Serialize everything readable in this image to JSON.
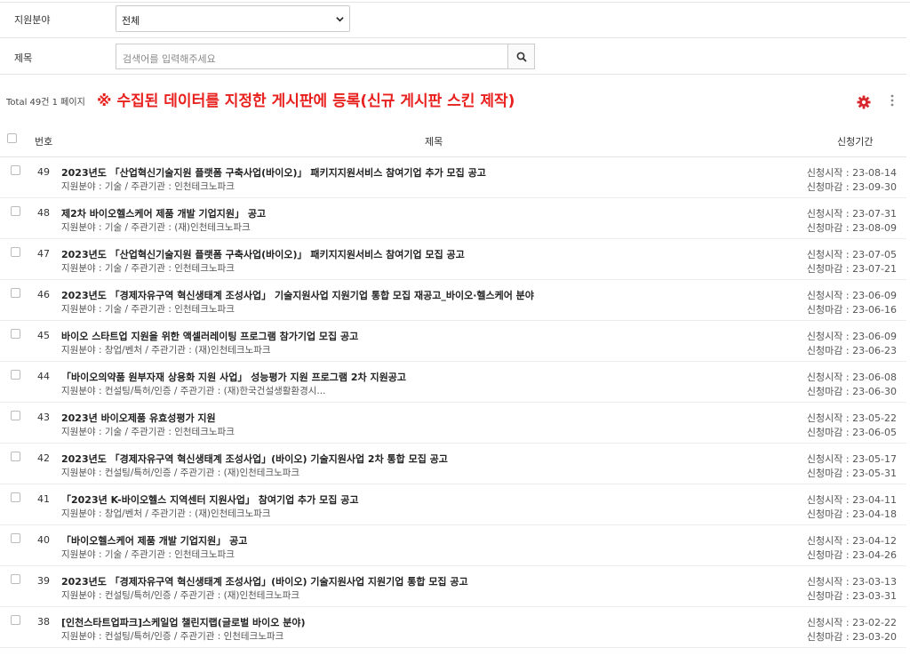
{
  "filters": {
    "category_label": "지원분야",
    "category_value": "전체",
    "title_label": "제목",
    "search_placeholder": "검색어를 입력해주세요"
  },
  "summary": {
    "total_text": "Total 49건 1 페이지",
    "notice": "※ 수집된 데이터를 지정한 게시판에 등록(신규 게시판 스킨 제작)"
  },
  "table": {
    "headers": {
      "no": "번호",
      "title": "제목",
      "period": "신청기간"
    },
    "rows": [
      {
        "no": "49",
        "title": "2023년도 「산업혁신기술지원 플랫폼 구축사업(바이오)」 패키지지원서비스 참여기업 추가 모집 공고",
        "meta": "지원분야 : 기술 / 주관기관 : 인천테크노파크",
        "start": "신청시작 : 23-08-14",
        "end": "신청마감 : 23-09-30"
      },
      {
        "no": "48",
        "title": "제2차 바이오헬스케어 제품 개발 기업지원」 공고",
        "meta": "지원분야 : 기술 / 주관기관 : (재)인천테크노파크",
        "start": "신청시작 : 23-07-31",
        "end": "신청마감 : 23-08-09"
      },
      {
        "no": "47",
        "title": "2023년도 「산업혁신기술지원 플랫폼 구축사업(바이오)」 패키지지원서비스 참여기업 모집 공고",
        "meta": "지원분야 : 기술 / 주관기관 : 인천테크노파크",
        "start": "신청시작 : 23-07-05",
        "end": "신청마감 : 23-07-21"
      },
      {
        "no": "46",
        "title": "2023년도 「경제자유구역 혁신생태계 조성사업」 기술지원사업 지원기업 통합 모집 재공고_바이오·헬스케어 분야",
        "meta": "지원분야 : 기술 / 주관기관 : 인천테크노파크",
        "start": "신청시작 : 23-06-09",
        "end": "신청마감 : 23-06-16"
      },
      {
        "no": "45",
        "title": "바이오 스타트업 지원을 위한 액셀러레이팅 프로그램 참가기업 모집 공고",
        "meta": "지원분야 : 창업/벤처 / 주관기관 : (재)인천테크노파크",
        "start": "신청시작 : 23-06-09",
        "end": "신청마감 : 23-06-23"
      },
      {
        "no": "44",
        "title": "「바이오의약품 원부자재 상용화 지원 사업」 성능평가 지원 프로그램 2차 지원공고",
        "meta": "지원분야 : 컨설팅/특허/인증 / 주관기관 : (재)한국건설생활환경시...",
        "start": "신청시작 : 23-06-08",
        "end": "신청마감 : 23-06-30"
      },
      {
        "no": "43",
        "title": "2023년 바이오제품 유효성평가 지원",
        "meta": "지원분야 : 기술 / 주관기관 : 인천테크노파크",
        "start": "신청시작 : 23-05-22",
        "end": "신청마감 : 23-06-05"
      },
      {
        "no": "42",
        "title": "2023년도 「경제자유구역 혁신생태계 조성사업」(바이오) 기술지원사업 2차 통합 모집 공고",
        "meta": "지원분야 : 컨설팅/특허/인증 / 주관기관 : (재)인천테크노파크",
        "start": "신청시작 : 23-05-17",
        "end": "신청마감 : 23-05-31"
      },
      {
        "no": "41",
        "title": "「2023년 K-바이오헬스 지역센터 지원사업」 참여기업 추가 모집 공고",
        "meta": "지원분야 : 창업/벤처 / 주관기관 : (재)인천테크노파크",
        "start": "신청시작 : 23-04-11",
        "end": "신청마감 : 23-04-18"
      },
      {
        "no": "40",
        "title": "「바이오헬스케어 제품 개발 기업지원」 공고",
        "meta": "지원분야 : 기술 / 주관기관 : 인천테크노파크",
        "start": "신청시작 : 23-04-12",
        "end": "신청마감 : 23-04-26"
      },
      {
        "no": "39",
        "title": "2023년도 「경제자유구역 혁신생태계 조성사업」(바이오) 기술지원사업 지원기업 통합 모집 공고",
        "meta": "지원분야 : 컨설팅/특허/인증 / 주관기관 : (재)인천테크노파크",
        "start": "신청시작 : 23-03-13",
        "end": "신청마감 : 23-03-31"
      },
      {
        "no": "38",
        "title": "[인천스타트업파크]스케일업 챌린지랩(글로벌 바이오 분야)",
        "meta": "지원분야 : 컨설팅/특허/인증 / 주관기관 : 인천테크노파크",
        "start": "신청시작 : 23-02-22",
        "end": "신청마감 : 23-03-20"
      }
    ]
  },
  "icons": {
    "select": "chevron-down-icon",
    "search": "search-icon",
    "settings": "gear-icon",
    "more": "kebab-icon"
  },
  "colors": {
    "notice": "#e8201e",
    "gear": "#d9272e"
  }
}
